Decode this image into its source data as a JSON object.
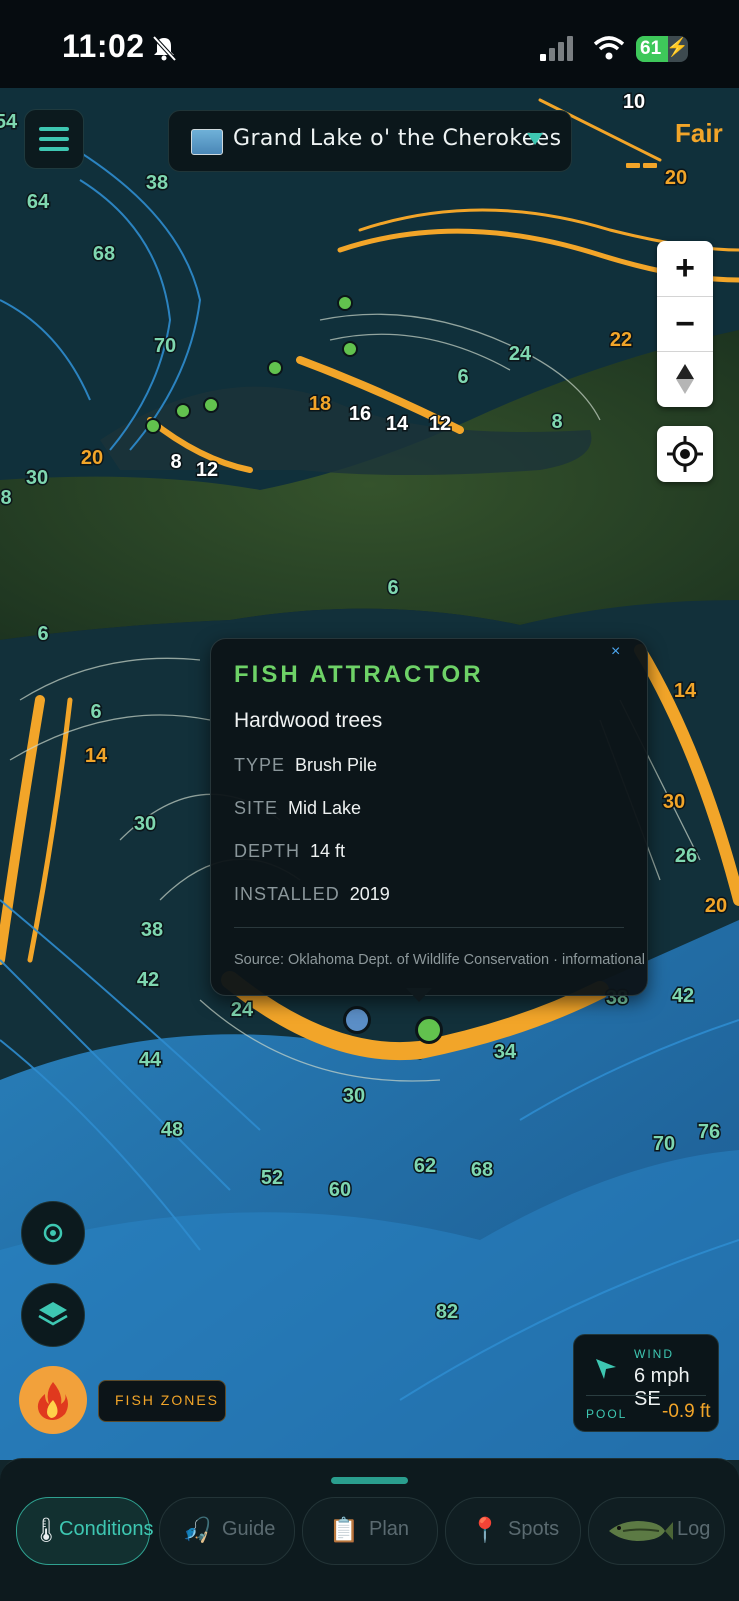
{
  "status_bar": {
    "time": "11:02",
    "battery": "61"
  },
  "header": {
    "lake_name": "Grand Lake o' the Cherokees",
    "rating": "Fair"
  },
  "map": {
    "depth_labels": [
      {
        "v": "10",
        "t": "w"
      },
      {
        "v": "20",
        "t": "o"
      },
      {
        "v": "38",
        "t": "g"
      },
      {
        "v": "64",
        "t": "g"
      },
      {
        "v": "68",
        "t": "g"
      },
      {
        "v": "70",
        "t": "g"
      },
      {
        "v": "22",
        "t": "o"
      },
      {
        "v": "24",
        "t": "g"
      },
      {
        "v": "6",
        "t": "g"
      },
      {
        "v": "18",
        "t": "o"
      },
      {
        "v": "16",
        "t": "w"
      },
      {
        "v": "14",
        "t": "w"
      },
      {
        "v": "12",
        "t": "w"
      },
      {
        "v": "8",
        "t": "g"
      },
      {
        "v": "20",
        "t": "o"
      },
      {
        "v": "8",
        "t": "w"
      },
      {
        "v": "12",
        "t": "w"
      },
      {
        "v": "30",
        "t": "g"
      },
      {
        "v": "6",
        "t": "g"
      },
      {
        "v": "6",
        "t": "g"
      },
      {
        "v": "6",
        "t": "g"
      },
      {
        "v": "14",
        "t": "o"
      },
      {
        "v": "14",
        "t": "o"
      },
      {
        "v": "30",
        "t": "g"
      },
      {
        "v": "30",
        "t": "o"
      },
      {
        "v": "26",
        "t": "g"
      },
      {
        "v": "20",
        "t": "o"
      },
      {
        "v": "38",
        "t": "g"
      },
      {
        "v": "42",
        "t": "g"
      },
      {
        "v": "24",
        "t": "g"
      },
      {
        "v": "38",
        "t": "g"
      },
      {
        "v": "42",
        "t": "g"
      },
      {
        "v": "44",
        "t": "g"
      },
      {
        "v": "34",
        "t": "g"
      },
      {
        "v": "30",
        "t": "g"
      },
      {
        "v": "48",
        "t": "g"
      },
      {
        "v": "52",
        "t": "g"
      },
      {
        "v": "60",
        "t": "g"
      },
      {
        "v": "62",
        "t": "g"
      },
      {
        "v": "68",
        "t": "g"
      },
      {
        "v": "70",
        "t": "g"
      },
      {
        "v": "76",
        "t": "g"
      },
      {
        "v": "82",
        "t": "g"
      },
      {
        "v": "54",
        "t": "g"
      },
      {
        "v": "8",
        "t": "g"
      }
    ]
  },
  "popup": {
    "title": "FISH ATTRACTOR",
    "close": "×",
    "subtitle": "Hardwood trees",
    "rows": [
      {
        "label": "TYPE",
        "value": "Brush Pile"
      },
      {
        "label": "SITE",
        "value": "Mid Lake"
      },
      {
        "label": "DEPTH",
        "value": "14 ft"
      },
      {
        "label": "INSTALLED",
        "value": "2019"
      }
    ],
    "source": "Source: Oklahoma Dept. of Wildlife Conservation · informational"
  },
  "fish_zones_label": "FISH ZONES",
  "wind": {
    "label": "WIND",
    "value": "6 mph SE",
    "pool_label": "POOL",
    "pool_value": "-0.9 ft"
  },
  "nav": [
    {
      "label": "Conditions",
      "icon": "thermometer-icon",
      "active": true
    },
    {
      "label": "Guide",
      "icon": "fisherman-icon",
      "active": false
    },
    {
      "label": "Plan",
      "icon": "clipboard-icon",
      "active": false
    },
    {
      "label": "Spots",
      "icon": "pin-icon",
      "active": false
    },
    {
      "label": "Log",
      "icon": "bass-icon",
      "active": false
    }
  ],
  "colors": {
    "accent": "#3ec7b2",
    "warning": "#f2a529",
    "green": "#6ed267",
    "deep_water": "#2e8ccf"
  }
}
